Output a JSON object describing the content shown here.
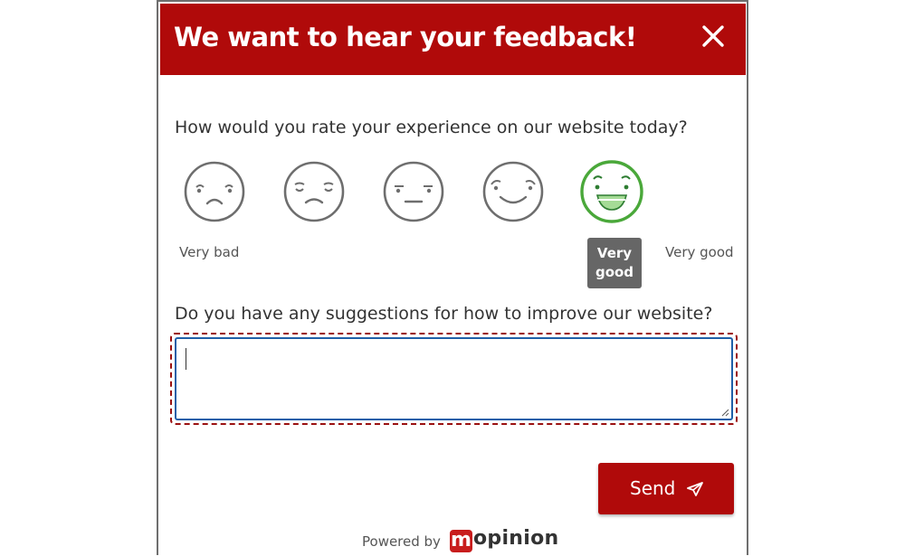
{
  "header": {
    "title": "We want to hear your feedback!",
    "close_icon": "close-icon"
  },
  "question_rating": "How would you rate your experience on our website today?",
  "rating": {
    "options": [
      {
        "icon": "very-bad-face-icon"
      },
      {
        "icon": "bad-face-icon"
      },
      {
        "icon": "neutral-face-icon"
      },
      {
        "icon": "good-face-icon"
      },
      {
        "icon": "very-good-face-icon"
      }
    ],
    "selected_index": 4,
    "label_low": "Very bad",
    "label_high": "Very good",
    "tooltip_line1": "Very",
    "tooltip_line2": "good"
  },
  "question_suggestions": "Do you have any suggestions for how to improve our website?",
  "suggestions_value": "",
  "send": {
    "label": "Send",
    "icon": "send-icon"
  },
  "footer": {
    "powered_by": "Powered by",
    "logo_letter": "m",
    "logo_rest": "opinion"
  },
  "colors": {
    "brand_red": "#b00a0a",
    "selected_green": "#4aa83a",
    "focus_blue": "#1f5fa8",
    "face_gray": "#6e6e6e"
  }
}
